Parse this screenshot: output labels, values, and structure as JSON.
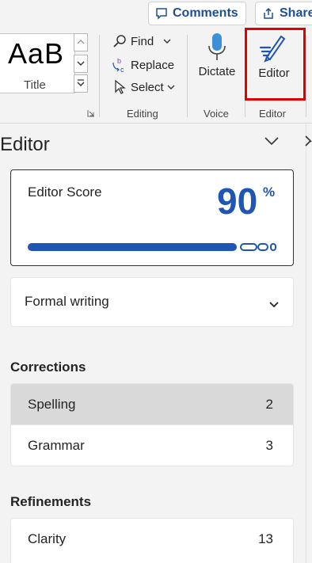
{
  "topbar": {
    "comments_label": "Comments",
    "share_label": "Share"
  },
  "ribbon": {
    "styles": {
      "sample": "AaB",
      "name": "Title"
    },
    "editing": {
      "find_label": "Find",
      "replace_label": "Replace",
      "select_label": "Select",
      "group_label": "Editing"
    },
    "voice": {
      "dictate_label": "Dictate",
      "group_label": "Voice"
    },
    "editor": {
      "editor_label": "Editor",
      "group_label": "Editor"
    },
    "highlight_color": "#e00000"
  },
  "pane": {
    "title": "Editor",
    "score": {
      "label": "Editor Score",
      "value": "90",
      "unit": "%",
      "progress_fraction": 0.9
    },
    "mode": {
      "selected": "Formal writing"
    },
    "corrections": {
      "heading": "Corrections",
      "items": [
        {
          "label": "Spelling",
          "count": "2"
        },
        {
          "label": "Grammar",
          "count": "3"
        }
      ]
    },
    "refinements": {
      "heading": "Refinements",
      "items": [
        {
          "label": "Clarity",
          "count": "13"
        }
      ]
    },
    "accent_color": "#1f56b3"
  }
}
